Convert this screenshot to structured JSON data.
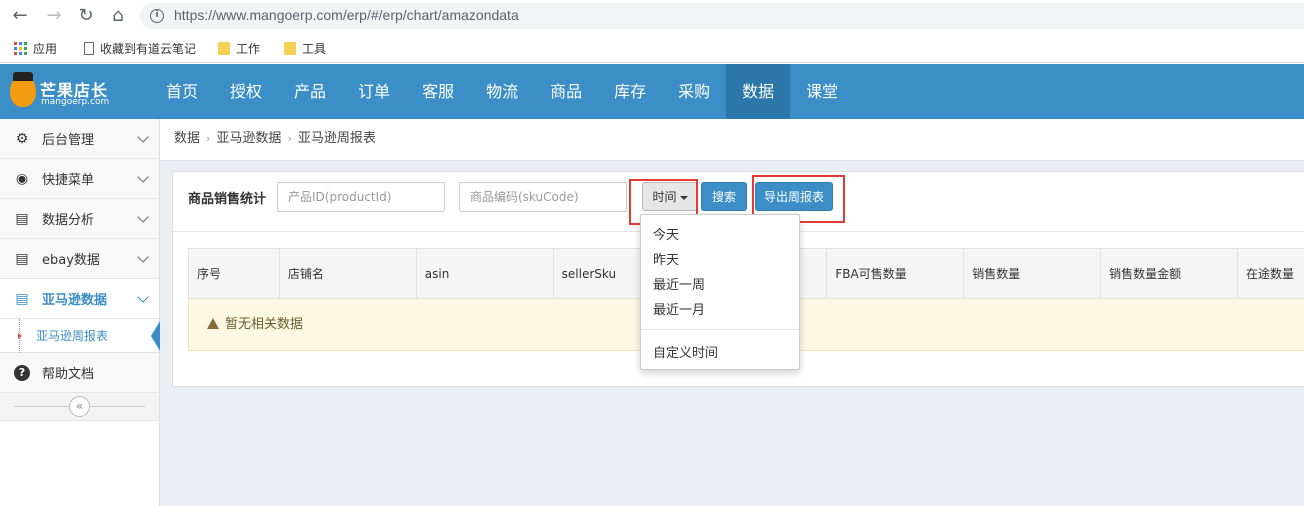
{
  "browser": {
    "url": "https://www.mangoerp.com/erp/#/erp/chart/amazondata",
    "bookmarks": [
      "应用",
      "收藏到有道云笔记",
      "工作",
      "工具"
    ]
  },
  "app": {
    "logo_title": "芒果店长",
    "logo_sub": "mangoerp.com",
    "nav": [
      "首页",
      "授权",
      "产品",
      "订单",
      "客服",
      "物流",
      "商品",
      "库存",
      "采购",
      "数据",
      "课堂"
    ],
    "nav_active": "数据"
  },
  "sidebar": {
    "items": [
      {
        "label": "后台管理",
        "icon": "gear-icon"
      },
      {
        "label": "快捷菜单",
        "icon": "target-icon"
      },
      {
        "label": "数据分析",
        "icon": "report-icon"
      },
      {
        "label": "ebay数据",
        "icon": "report-icon"
      },
      {
        "label": "亚马逊数据",
        "icon": "report-icon"
      }
    ],
    "sub_item": "亚马逊周报表",
    "help": "帮助文档",
    "collapse_glyph": "«"
  },
  "breadcrumb": [
    "数据",
    "亚马逊数据",
    "亚马逊周报表"
  ],
  "filters": {
    "label": "商品销售统计",
    "product_placeholder": "产品ID(productId)",
    "sku_placeholder": "商品编码(skuCode)",
    "time_button": "时间",
    "search_button": "搜索",
    "export_button": "导出周报表"
  },
  "time_menu": [
    "今天",
    "昨天",
    "最近一周",
    "最近一月",
    "自定义时间"
  ],
  "table": {
    "columns": [
      "序号",
      "店铺名",
      "asin",
      "sellerSku",
      "",
      "FBA可售数量",
      "销售数量",
      "销售数量金额",
      "在途数量"
    ],
    "empty_text": "暂无相关数据"
  },
  "colors": {
    "nav_bg": "#3b8ec6",
    "nav_active": "#2c77a9",
    "highlight": "#e53935"
  }
}
